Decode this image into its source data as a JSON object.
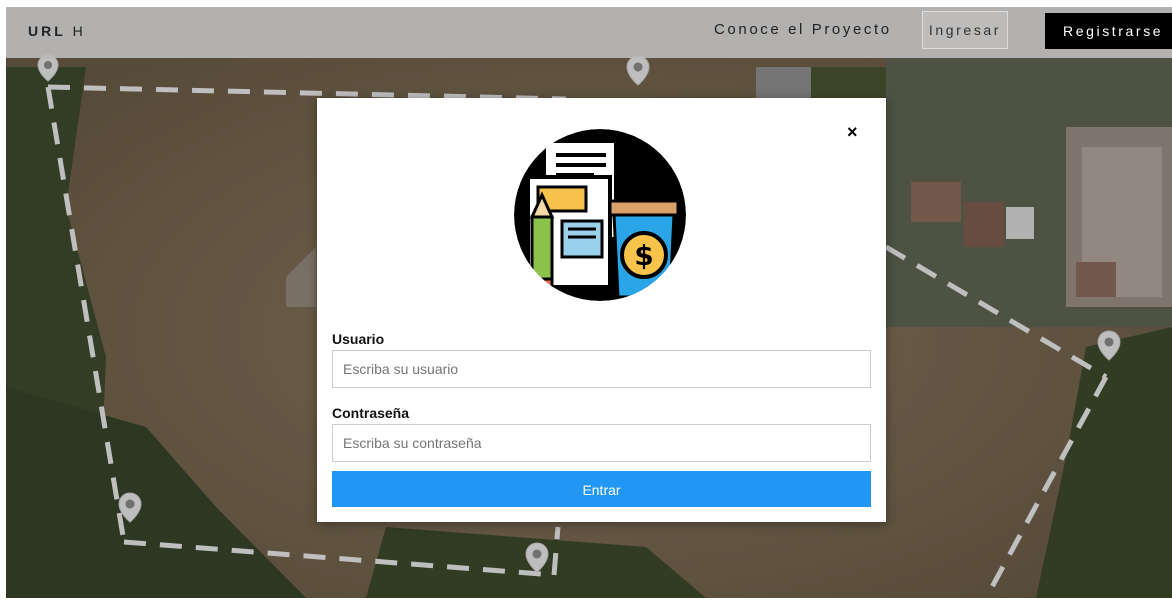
{
  "header": {
    "brand_bold": "URL",
    "brand_light": "H",
    "nav_link": "Conoce el Proyecto",
    "login_label": "Ingresar",
    "register_label": "Registrarse"
  },
  "modal": {
    "close_label": "×",
    "username_label": "Usuario",
    "username_placeholder": "Escriba su usuario",
    "username_value": "",
    "password_label": "Contraseña",
    "password_placeholder": "Escriba su contraseña",
    "password_value": "",
    "submit_label": "Entrar",
    "illustration_icon": "documents-pencil-coin-cup-icon",
    "accent_color": "#2196F3"
  },
  "background": {
    "description_icon": "aerial-plot-map-pins"
  }
}
